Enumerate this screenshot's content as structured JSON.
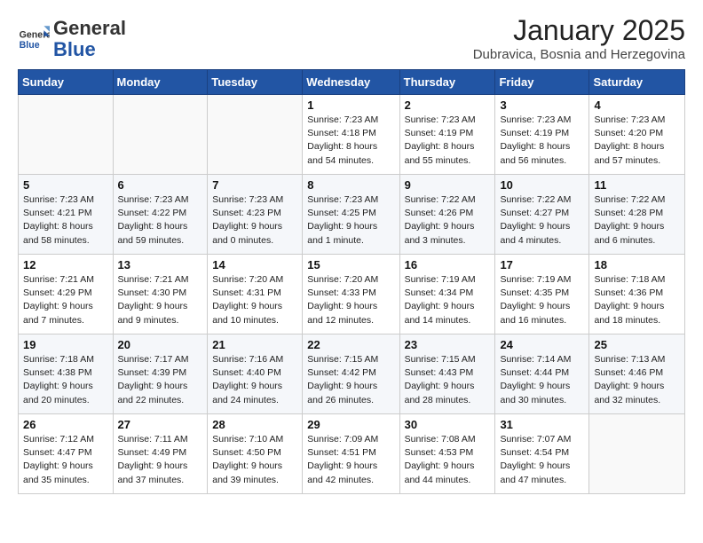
{
  "header": {
    "logo_general": "General",
    "logo_blue": "Blue",
    "month_title": "January 2025",
    "location": "Dubravica, Bosnia and Herzegovina"
  },
  "weekdays": [
    "Sunday",
    "Monday",
    "Tuesday",
    "Wednesday",
    "Thursday",
    "Friday",
    "Saturday"
  ],
  "weeks": [
    [
      {
        "day": "",
        "info": ""
      },
      {
        "day": "",
        "info": ""
      },
      {
        "day": "",
        "info": ""
      },
      {
        "day": "1",
        "info": "Sunrise: 7:23 AM\nSunset: 4:18 PM\nDaylight: 8 hours\nand 54 minutes."
      },
      {
        "day": "2",
        "info": "Sunrise: 7:23 AM\nSunset: 4:19 PM\nDaylight: 8 hours\nand 55 minutes."
      },
      {
        "day": "3",
        "info": "Sunrise: 7:23 AM\nSunset: 4:19 PM\nDaylight: 8 hours\nand 56 minutes."
      },
      {
        "day": "4",
        "info": "Sunrise: 7:23 AM\nSunset: 4:20 PM\nDaylight: 8 hours\nand 57 minutes."
      }
    ],
    [
      {
        "day": "5",
        "info": "Sunrise: 7:23 AM\nSunset: 4:21 PM\nDaylight: 8 hours\nand 58 minutes."
      },
      {
        "day": "6",
        "info": "Sunrise: 7:23 AM\nSunset: 4:22 PM\nDaylight: 8 hours\nand 59 minutes."
      },
      {
        "day": "7",
        "info": "Sunrise: 7:23 AM\nSunset: 4:23 PM\nDaylight: 9 hours\nand 0 minutes."
      },
      {
        "day": "8",
        "info": "Sunrise: 7:23 AM\nSunset: 4:25 PM\nDaylight: 9 hours\nand 1 minute."
      },
      {
        "day": "9",
        "info": "Sunrise: 7:22 AM\nSunset: 4:26 PM\nDaylight: 9 hours\nand 3 minutes."
      },
      {
        "day": "10",
        "info": "Sunrise: 7:22 AM\nSunset: 4:27 PM\nDaylight: 9 hours\nand 4 minutes."
      },
      {
        "day": "11",
        "info": "Sunrise: 7:22 AM\nSunset: 4:28 PM\nDaylight: 9 hours\nand 6 minutes."
      }
    ],
    [
      {
        "day": "12",
        "info": "Sunrise: 7:21 AM\nSunset: 4:29 PM\nDaylight: 9 hours\nand 7 minutes."
      },
      {
        "day": "13",
        "info": "Sunrise: 7:21 AM\nSunset: 4:30 PM\nDaylight: 9 hours\nand 9 minutes."
      },
      {
        "day": "14",
        "info": "Sunrise: 7:20 AM\nSunset: 4:31 PM\nDaylight: 9 hours\nand 10 minutes."
      },
      {
        "day": "15",
        "info": "Sunrise: 7:20 AM\nSunset: 4:33 PM\nDaylight: 9 hours\nand 12 minutes."
      },
      {
        "day": "16",
        "info": "Sunrise: 7:19 AM\nSunset: 4:34 PM\nDaylight: 9 hours\nand 14 minutes."
      },
      {
        "day": "17",
        "info": "Sunrise: 7:19 AM\nSunset: 4:35 PM\nDaylight: 9 hours\nand 16 minutes."
      },
      {
        "day": "18",
        "info": "Sunrise: 7:18 AM\nSunset: 4:36 PM\nDaylight: 9 hours\nand 18 minutes."
      }
    ],
    [
      {
        "day": "19",
        "info": "Sunrise: 7:18 AM\nSunset: 4:38 PM\nDaylight: 9 hours\nand 20 minutes."
      },
      {
        "day": "20",
        "info": "Sunrise: 7:17 AM\nSunset: 4:39 PM\nDaylight: 9 hours\nand 22 minutes."
      },
      {
        "day": "21",
        "info": "Sunrise: 7:16 AM\nSunset: 4:40 PM\nDaylight: 9 hours\nand 24 minutes."
      },
      {
        "day": "22",
        "info": "Sunrise: 7:15 AM\nSunset: 4:42 PM\nDaylight: 9 hours\nand 26 minutes."
      },
      {
        "day": "23",
        "info": "Sunrise: 7:15 AM\nSunset: 4:43 PM\nDaylight: 9 hours\nand 28 minutes."
      },
      {
        "day": "24",
        "info": "Sunrise: 7:14 AM\nSunset: 4:44 PM\nDaylight: 9 hours\nand 30 minutes."
      },
      {
        "day": "25",
        "info": "Sunrise: 7:13 AM\nSunset: 4:46 PM\nDaylight: 9 hours\nand 32 minutes."
      }
    ],
    [
      {
        "day": "26",
        "info": "Sunrise: 7:12 AM\nSunset: 4:47 PM\nDaylight: 9 hours\nand 35 minutes."
      },
      {
        "day": "27",
        "info": "Sunrise: 7:11 AM\nSunset: 4:49 PM\nDaylight: 9 hours\nand 37 minutes."
      },
      {
        "day": "28",
        "info": "Sunrise: 7:10 AM\nSunset: 4:50 PM\nDaylight: 9 hours\nand 39 minutes."
      },
      {
        "day": "29",
        "info": "Sunrise: 7:09 AM\nSunset: 4:51 PM\nDaylight: 9 hours\nand 42 minutes."
      },
      {
        "day": "30",
        "info": "Sunrise: 7:08 AM\nSunset: 4:53 PM\nDaylight: 9 hours\nand 44 minutes."
      },
      {
        "day": "31",
        "info": "Sunrise: 7:07 AM\nSunset: 4:54 PM\nDaylight: 9 hours\nand 47 minutes."
      },
      {
        "day": "",
        "info": ""
      }
    ]
  ]
}
